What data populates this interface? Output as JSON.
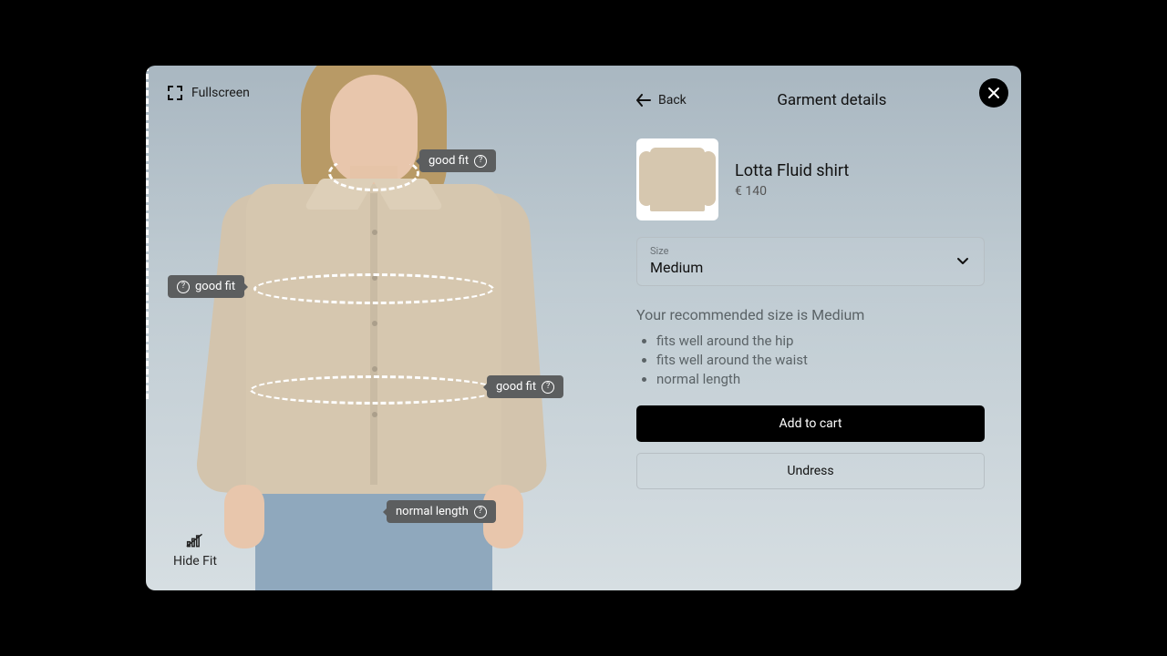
{
  "controls": {
    "fullscreen": "Fullscreen",
    "back": "Back",
    "hide_fit": "Hide Fit"
  },
  "header": {
    "title": "Garment details"
  },
  "product": {
    "name": "Lotta Fluid shirt",
    "price": "€ 140"
  },
  "size": {
    "label": "Size",
    "value": "Medium"
  },
  "recommendation": {
    "text": "Your recommended size is Medium",
    "points": {
      "0": "fits well around the hip",
      "1": "fits well around the waist",
      "2": "normal length"
    }
  },
  "actions": {
    "add_to_cart": "Add to cart",
    "undress": "Undress"
  },
  "fit_badges": {
    "neck": "good fit",
    "chest": "good fit",
    "waist": "good fit",
    "length": "normal length"
  }
}
